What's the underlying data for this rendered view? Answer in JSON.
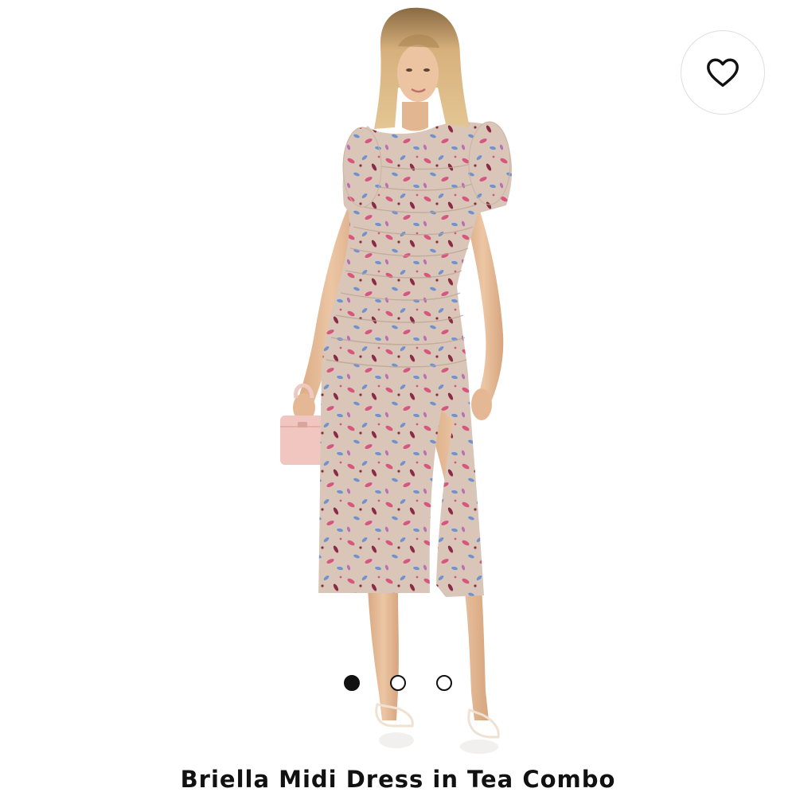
{
  "gallery": {
    "favorite_icon": "heart-outline-icon",
    "page_count": 3,
    "active_index": 0
  },
  "product": {
    "title": "Briella Midi Dress in Tea Combo"
  },
  "colors": {
    "background": "#ffffff",
    "text": "#111111",
    "dress": "#d9c6b8",
    "print_pink": "#d6567d",
    "print_blue": "#6e93cf",
    "print_wine": "#8a2b45",
    "bag": "#f1c6c0",
    "skin": "#e8bf9c",
    "hair": "#d8b27d"
  }
}
